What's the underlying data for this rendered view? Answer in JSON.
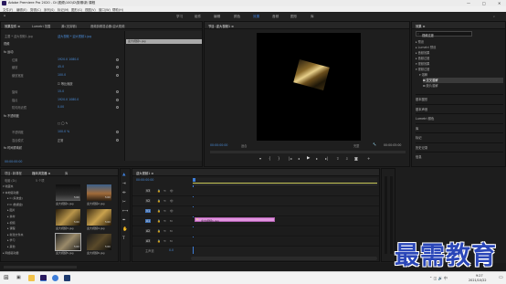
{
  "window": {
    "title": "Adobe Premiere Pro 2020 - D:\\视频\\100\\D\\剪辑\\新 课程",
    "controls": [
      "—",
      "□",
      "✕"
    ]
  },
  "menu": [
    "文件(F)",
    "编辑(E)",
    "剪辑(C)",
    "序列(S)",
    "标记(M)",
    "图形(G)",
    "视图(V)",
    "窗口(W)",
    "帮助(H)"
  ],
  "workspaces": [
    "学习",
    "组件",
    "编辑",
    "颜色",
    "效果",
    "音频",
    "图形",
    "库"
  ],
  "workspace_active": "效果",
  "effect_controls": {
    "tabs": [
      "效果控件 ≡",
      "Lumetri 范围",
      "源:(无剪辑)",
      "音频剪辑混合器:迎大视频"
    ],
    "source_label": "主要 * 迎大视频1.jpg",
    "sequence_label": "迎大视频 * 迎大视频1.jpg",
    "clip_name": "迎大视频1.jpg",
    "rows": [
      {
        "name": "视频",
        "value": ""
      },
      {
        "name": "fx 运动",
        "value": ""
      },
      {
        "name": "位置",
        "value": "1920.0   1080.0"
      },
      {
        "name": "缩放",
        "value": "45.0"
      },
      {
        "name": "缩放宽度",
        "value": "100.0"
      },
      {
        "name": "",
        "value": "☑ 等比缩放"
      },
      {
        "name": "旋转",
        "value": "15.0"
      },
      {
        "name": "锚点",
        "value": "1920.0   1080.0"
      },
      {
        "name": "防闪烁滤镜",
        "value": "0.00"
      },
      {
        "name": "fx 不透明度",
        "value": ""
      },
      {
        "name": "",
        "value": "□ ◯ ✎"
      },
      {
        "name": "不透明度",
        "value": "100.0 %"
      },
      {
        "name": "混合模式",
        "value": "正常"
      },
      {
        "name": "fx 时间重映射",
        "value": ""
      }
    ],
    "timecode": "00:00:00:00"
  },
  "program": {
    "tab": "节目: 迎大视频1 ≡",
    "timecode_left": "00:00:00:00",
    "fit": "适合",
    "quality": "完整",
    "timecode_right": "00:00:05:00"
  },
  "effects_panel": {
    "title": "效果 ≡",
    "search": "视频过渡",
    "tree": [
      {
        "label": "▸ 预设",
        "indent": 0
      },
      {
        "label": "▸ Lumetri 预设",
        "indent": 0
      },
      {
        "label": "▸ 音频效果",
        "indent": 0
      },
      {
        "label": "▸ 音频过渡",
        "indent": 0
      },
      {
        "label": "▾ 视频效果",
        "indent": 0
      },
      {
        "label": "▾ 视频过渡",
        "indent": 0
      },
      {
        "label": "▾ 溶解",
        "indent": 1
      },
      {
        "label": "⊠ 交叉溶解",
        "indent": 2,
        "selected": true
      },
      {
        "label": "⊠ 胶片溶解",
        "indent": 2
      }
    ],
    "sections": [
      "基本图形",
      "基本声音",
      "Lumetri 颜色",
      "库",
      "标记",
      "历史记录",
      "信息"
    ]
  },
  "project": {
    "tabs": [
      "项目: 新课程",
      "媒体浏览器 ≡",
      "库"
    ],
    "path": "电脑 (D:)",
    "count": "5 个项",
    "tree": [
      "▾ 收藏夹",
      "▾ 本地驱动器",
      "▸ C (系统盘)",
      "▾ D (数据盘)",
      "▸ 图片",
      "▸ 素材",
      "▸ 视频",
      "▸ 课程",
      "▸ 新建文件夹",
      "▸ 学习",
      "▸ 其他",
      "▸ 网络驱动器"
    ],
    "files": [
      {
        "name": "迎大视频1.jpg",
        "dur": "5:00"
      },
      {
        "name": "迎大视频2.jpg",
        "dur": "5:00"
      },
      {
        "name": "迎大视频3.jpg",
        "dur": "5:00"
      },
      {
        "name": "迎大视频4.jpg",
        "dur": "5:00"
      },
      {
        "name": "迎大视频5.jpg",
        "dur": "5:00"
      },
      {
        "name": "迎大视频6.jpg",
        "dur": "5:00"
      }
    ]
  },
  "timeline": {
    "tab": "迎大视频1 ≡",
    "timecode": "00:00:00:00",
    "tracks": [
      "V3",
      "V2",
      "V1",
      "A1",
      "A2",
      "A3"
    ],
    "master": "主声道",
    "master_val": "0.0",
    "clip": "迎大视频1.jpg"
  },
  "watermark": "最需教育",
  "taskbar": {
    "time": "9:27",
    "date": "2021/10/22"
  }
}
